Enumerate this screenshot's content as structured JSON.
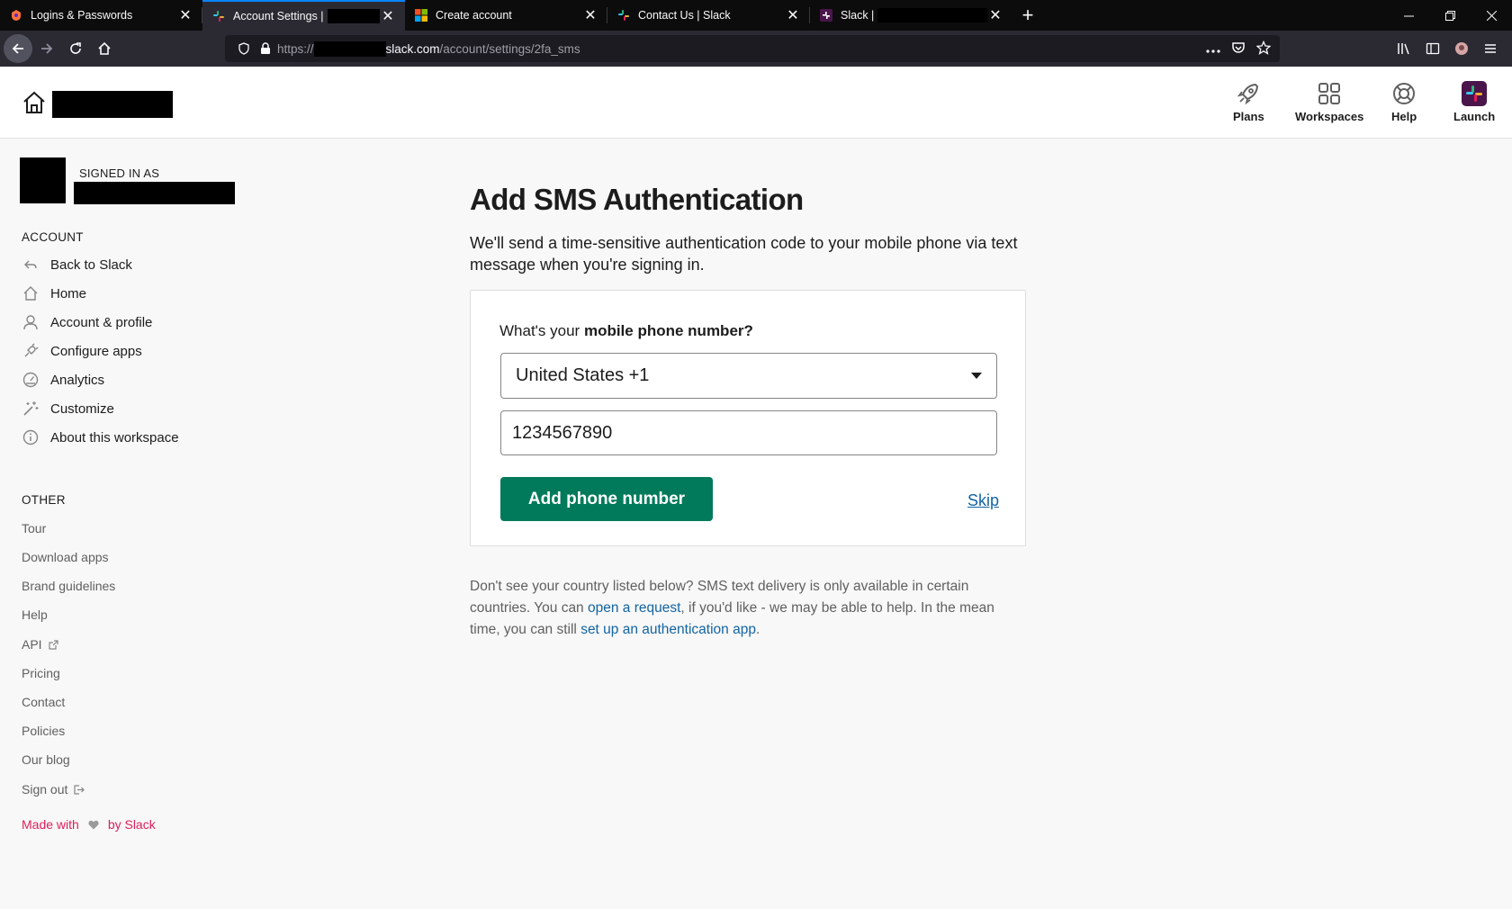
{
  "browser": {
    "tabs": [
      {
        "title": "Logins & Passwords",
        "active": false
      },
      {
        "title": "Account Settings | ",
        "active": true
      },
      {
        "title": "Create account",
        "active": false
      },
      {
        "title": "Contact Us | Slack",
        "active": false
      },
      {
        "title": "Slack | ",
        "active": false
      }
    ],
    "url": {
      "protocol": "https://",
      "host": "slack.com",
      "path": "/account/settings/2fa_sms"
    }
  },
  "header": {
    "nav": [
      {
        "label": "Plans",
        "icon": "rocket-icon"
      },
      {
        "label": "Workspaces",
        "icon": "grid-icon"
      },
      {
        "label": "Help",
        "icon": "lifebuoy-icon"
      },
      {
        "label": "Launch",
        "icon": "slack-logo-icon"
      }
    ]
  },
  "sidebar": {
    "signed_in_label": "SIGNED IN AS",
    "account_heading": "ACCOUNT",
    "account_items": [
      {
        "label": "Back to Slack",
        "icon": "back-arrow-icon"
      },
      {
        "label": "Home",
        "icon": "home-icon"
      },
      {
        "label": "Account & profile",
        "icon": "user-icon"
      },
      {
        "label": "Configure apps",
        "icon": "plug-icon"
      },
      {
        "label": "Analytics",
        "icon": "gauge-icon"
      },
      {
        "label": "Customize",
        "icon": "magic-wand-icon"
      },
      {
        "label": "About this workspace",
        "icon": "info-icon"
      }
    ],
    "other_heading": "OTHER",
    "other_items": [
      {
        "label": "Tour"
      },
      {
        "label": "Download apps"
      },
      {
        "label": "Brand guidelines"
      },
      {
        "label": "Help"
      },
      {
        "label": "API"
      },
      {
        "label": "Pricing"
      },
      {
        "label": "Contact"
      },
      {
        "label": "Policies"
      },
      {
        "label": "Our blog"
      },
      {
        "label": "Sign out"
      }
    ],
    "made_with": {
      "before": "Made with",
      "after": "by Slack"
    }
  },
  "main": {
    "title": "Add SMS Authentication",
    "intro": "We'll send a time-sensitive authentication code to your mobile phone via text message when you're signing in.",
    "question_prefix": "What's your ",
    "question_bold": "mobile phone number?",
    "country_selected": "United States +1",
    "phone_value": "1234567890",
    "add_button": "Add phone number",
    "skip_link": "Skip",
    "note": {
      "part1": "Don't see your country listed below? SMS text delivery is only available in certain countries. You can ",
      "link1": "open a request",
      "part2": ", if you'd like - we may be able to help. In the mean time, you can still ",
      "link2": "set up an authentication app",
      "part3": "."
    }
  },
  "colors": {
    "primary_button": "#007a5a",
    "link": "#1264a3",
    "made_with": "#e01e5a",
    "active_tab_accent": "#0a84ff"
  }
}
